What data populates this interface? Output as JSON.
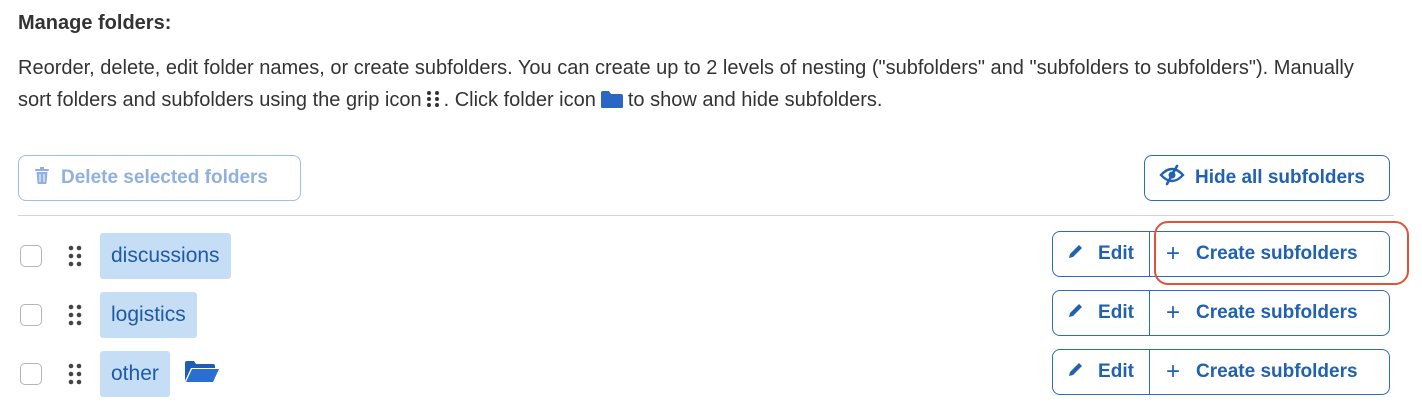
{
  "header": {
    "title": "Manage folders:",
    "description_part1": "Reorder, delete, edit folder names, or create subfolders. You can create up to 2 levels of nesting (\"subfolders\" and \"subfolders to subfolders\"). Manually sort folders and subfolders using the grip icon",
    "description_part2": ". Click folder icon",
    "description_part3": "to show and hide subfolders.",
    "grip_icon": "grip-icon",
    "folder_icon": "folder-icon"
  },
  "toolbar": {
    "delete_label": "Delete selected folders",
    "delete_icon": "trash-icon",
    "hide_label": "Hide all subfolders",
    "hide_icon": "eye-slash-icon"
  },
  "folders": [
    {
      "name": "discussions",
      "checked": false,
      "has_subfolders": false,
      "edit_label": "Edit",
      "create_label": "Create subfolders"
    },
    {
      "name": "logistics",
      "checked": false,
      "has_subfolders": false,
      "edit_label": "Edit",
      "create_label": "Create subfolders"
    },
    {
      "name": "other",
      "checked": false,
      "has_subfolders": true,
      "edit_label": "Edit",
      "create_label": "Create subfolders"
    }
  ],
  "colors": {
    "accent": "#2162b0",
    "label_bg": "#c6ddf6",
    "highlight": "#e0523a",
    "disabled": "#8fb1dc"
  }
}
